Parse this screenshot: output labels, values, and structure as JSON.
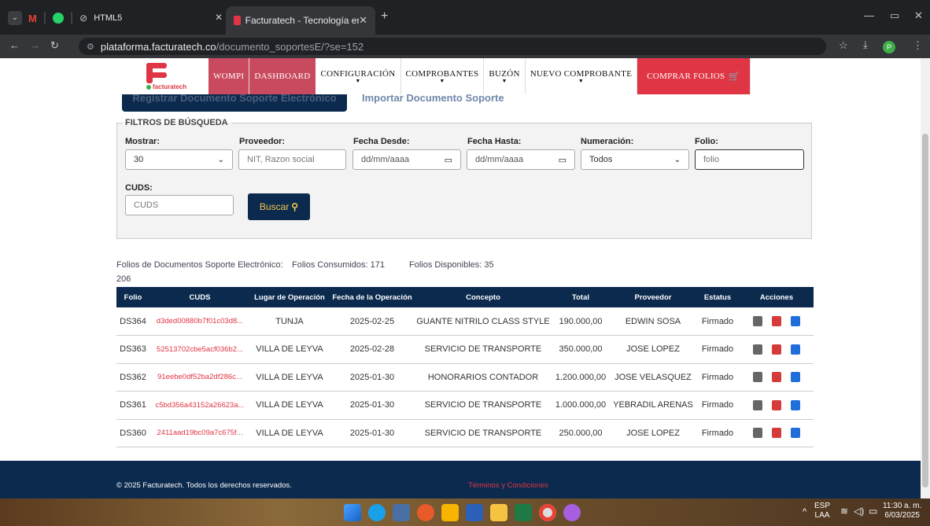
{
  "browser": {
    "pinned_tab_label": "HTML5",
    "active_tab_title": "Facturatech - Tecnología en fac",
    "new_tab_symbol": "+",
    "url_domain": "plataforma.facturatech.co",
    "url_path": "/documento_soportesE/?se=152",
    "profile_initial": "P"
  },
  "nav": {
    "logo_text": "facturatech",
    "items": [
      "WOMPI",
      "DASHBOARD",
      "CONFIGURACIÓN",
      "COMPROBANTES",
      "BUZÓN",
      "NUEVO COMPROBANTE"
    ],
    "cart_label": "COMPRAR FOLIOS"
  },
  "hidden_actions": {
    "register_label": "Registrar Documento Soporte Electrónico",
    "import_label": "Importar Documento Soporte"
  },
  "filters": {
    "legend": "FILTROS DE BÚSQUEDA",
    "mostrar_label": "Mostrar:",
    "mostrar_value": "30",
    "proveedor_label": "Proveedor:",
    "proveedor_placeholder": "NIT, Razon social",
    "fecha_desde_label": "Fecha Desde:",
    "fecha_desde_placeholder": "dd/mm/aaaa",
    "fecha_hasta_label": "Fecha Hasta:",
    "fecha_hasta_placeholder": "dd/mm/aaaa",
    "numeracion_label": "Numeración:",
    "numeracion_value": "Todos",
    "folio_label": "Folio:",
    "folio_placeholder": "folio",
    "cuds_label": "CUDS:",
    "cuds_placeholder": "CUDS",
    "buscar_label": "Buscar"
  },
  "stats": {
    "folios_total_label": "Folios de Documentos Soporte Electrónico:",
    "folios_total_value": "206",
    "consumidos": "Folios Consumidos: 171",
    "disponibles": "Folios Disponibles: 35"
  },
  "table": {
    "headers": [
      "Folio",
      "CUDS",
      "Lugar de Operación",
      "Fecha de la Operación",
      "Concepto",
      "Total",
      "Proveedor",
      "Estatus",
      "Acciones"
    ],
    "rows": [
      {
        "folio": "DS364",
        "cuds": "d3ded00880b7f01c03d8...",
        "lugar": "TUNJA",
        "fecha": "2025-02-25",
        "concepto": "GUANTE NITRILO CLASS STYLE",
        "total": "190.000,00",
        "proveedor": "EDWIN SOSA",
        "estatus": "Firmado"
      },
      {
        "folio": "DS363",
        "cuds": "52513702cbe5acf036b2...",
        "lugar": "VILLA DE LEYVA",
        "fecha": "2025-02-28",
        "concepto": "SERVICIO DE TRANSPORTE",
        "total": "350.000,00",
        "proveedor": "JOSE LOPEZ",
        "estatus": "Firmado"
      },
      {
        "folio": "DS362",
        "cuds": "91eebe0df52ba2df286c...",
        "lugar": "VILLA DE LEYVA",
        "fecha": "2025-01-30",
        "concepto": "HONORARIOS CONTADOR",
        "total": "1.200.000,00",
        "proveedor": "JOSE VELASQUEZ",
        "estatus": "Firmado"
      },
      {
        "folio": "DS361",
        "cuds": "c5bd356a43152a26623a...",
        "lugar": "VILLA DE LEYVA",
        "fecha": "2025-01-30",
        "concepto": "SERVICIO DE TRANSPORTE",
        "total": "1.000.000,00",
        "proveedor": "YEBRADIL ARENAS",
        "estatus": "Firmado"
      },
      {
        "folio": "DS360",
        "cuds": "2411aad19bc09a7c675f...",
        "lugar": "VILLA DE LEYVA",
        "fecha": "2025-01-30",
        "concepto": "SERVICIO DE TRANSPORTE",
        "total": "250.000,00",
        "proveedor": "JOSE LOPEZ",
        "estatus": "Firmado"
      }
    ]
  },
  "footer": {
    "copyright": "© 2025 Facturatech. Todos los derechos reservados.",
    "terms": "Términos y Condiciones"
  },
  "taskbar": {
    "lang_top": "ESP",
    "lang_bottom": "LAA",
    "time": "11:30 a. m.",
    "date": "6/03/2025"
  },
  "colors": {
    "navy": "#0b2a4e",
    "accent_red": "#e03544",
    "nav_highlight": "#c94a5e"
  }
}
